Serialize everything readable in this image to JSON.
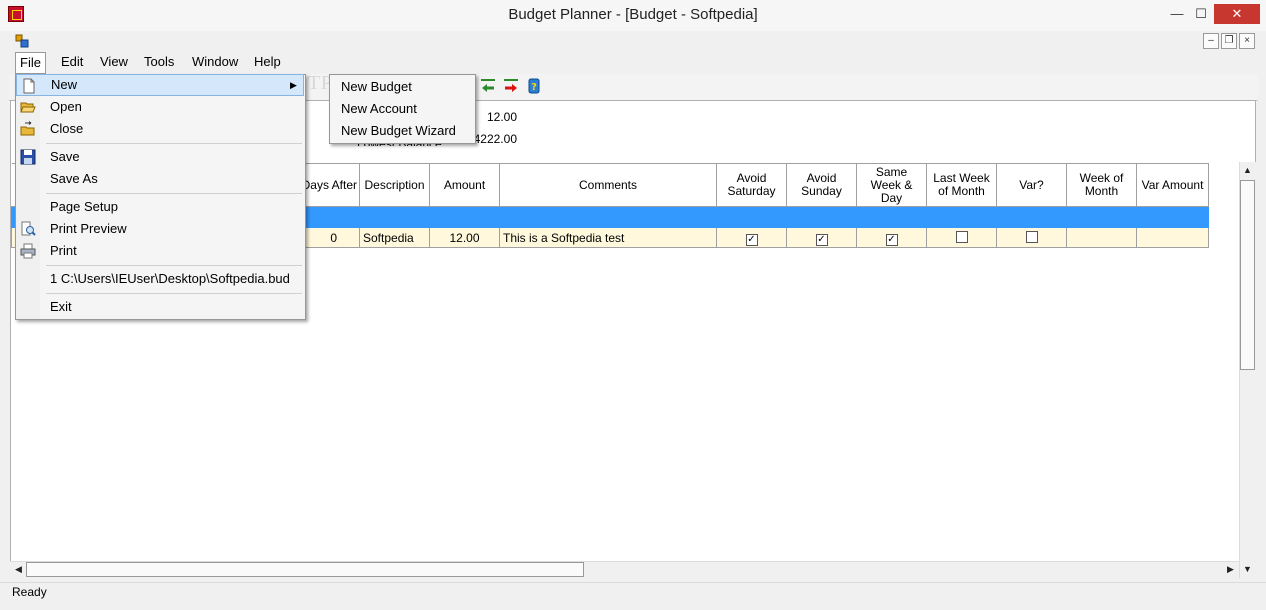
{
  "window": {
    "title": "Budget Planner - [Budget - Softpedia]",
    "minimize": "—",
    "maximize": "☐",
    "close": "✕"
  },
  "mdi": {
    "minimize": "–",
    "restore": "❐",
    "close": "×"
  },
  "menubar": [
    "File",
    "Edit",
    "View",
    "Tools",
    "Window",
    "Help"
  ],
  "file_menu": {
    "new": "New",
    "open": "Open",
    "close": "Close",
    "save": "Save",
    "save_as": "Save As",
    "page_setup": "Page Setup",
    "print_preview": "Print Preview",
    "print": "Print",
    "recent_1": "1 C:\\Users\\IEUser\\Desktop\\Softpedia.bud",
    "exit": "Exit"
  },
  "new_submenu": [
    "New Budget",
    "New Account",
    "New Budget Wizard"
  ],
  "summary": {
    "value_1": "12.00",
    "value_2": "4222.00",
    "label_2_partial": "Lowest Balance"
  },
  "grid": {
    "headers": [
      "Days After",
      "Description",
      "Amount",
      "Comments",
      "Avoid Saturday",
      "Avoid Sunday",
      "Same Week & Day",
      "Last Week of Month",
      "Var?",
      "Week of Month",
      "Var Amount"
    ],
    "row": {
      "days_after": "0",
      "description": "Softpedia",
      "amount": "12.00",
      "comments": "This is a Softpedia test",
      "avoid_saturday": true,
      "avoid_sunday": true,
      "same_week_day": true,
      "last_week_of_month": false,
      "var": false,
      "week_of_month": "",
      "var_amount": ""
    }
  },
  "status": "Ready",
  "watermark": "SOFTPEDIA",
  "colors": {
    "selection": "#3399ff",
    "row_highlight": "#fff8dc",
    "close_button": "#c7372f"
  }
}
